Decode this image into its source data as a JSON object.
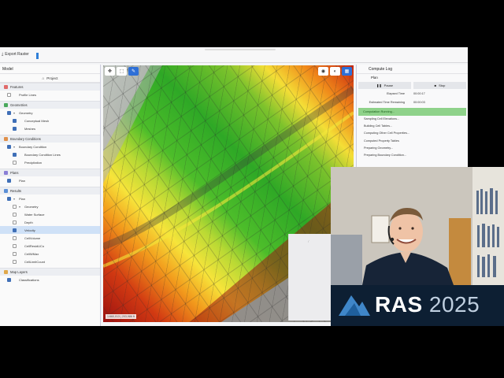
{
  "topbar": {
    "export_label": "Export Raster"
  },
  "model_panel": {
    "title": "Model",
    "project_label": "Project",
    "sections": [
      {
        "id": "features",
        "label": "Features",
        "color": "#e06a6a",
        "items": [
          {
            "label": "Profile Lines",
            "checked": false,
            "indent": 1
          }
        ]
      },
      {
        "id": "geometries",
        "label": "Geometries",
        "color": "#49a85c",
        "items": [
          {
            "label": "Geometry",
            "checked": true,
            "indent": 1,
            "caret": true
          },
          {
            "label": "Conceptual Mesh",
            "checked": true,
            "indent": 2
          },
          {
            "label": "Meshes",
            "checked": true,
            "indent": 2
          }
        ]
      },
      {
        "id": "boundary",
        "label": "Boundary Conditions",
        "color": "#e0904a",
        "items": [
          {
            "label": "Boundary Condition",
            "checked": true,
            "indent": 1,
            "caret": true
          },
          {
            "label": "Boundary Condition Lines",
            "checked": true,
            "indent": 2
          },
          {
            "label": "Precipitation",
            "checked": false,
            "indent": 2
          }
        ]
      },
      {
        "id": "plans",
        "label": "Plans",
        "color": "#8a7fd6",
        "items": [
          {
            "label": "Plan",
            "checked": true,
            "indent": 1
          }
        ]
      },
      {
        "id": "results",
        "label": "Results",
        "color": "#5b8fd6",
        "items": [
          {
            "label": "Plan",
            "checked": true,
            "indent": 1,
            "caret": true
          },
          {
            "label": "Geometry",
            "checked": false,
            "indent": 2,
            "caret": true
          },
          {
            "label": "Water Surface",
            "checked": false,
            "indent": 2
          },
          {
            "label": "Depth",
            "checked": false,
            "indent": 2
          },
          {
            "label": "Velocity",
            "checked": true,
            "indent": 2,
            "selected": true
          },
          {
            "label": "CellVolume",
            "checked": false,
            "indent": 2
          },
          {
            "label": "CellResidUCo",
            "checked": false,
            "indent": 2
          },
          {
            "label": "CellWMax",
            "checked": false,
            "indent": 2
          },
          {
            "label": "CellLimitCount",
            "checked": false,
            "indent": 2
          }
        ]
      },
      {
        "id": "maplayers",
        "label": "Map Layers",
        "color": "#e0a84a",
        "items": [
          {
            "label": "Classifications",
            "checked": true,
            "indent": 1
          }
        ]
      }
    ]
  },
  "map": {
    "scale_text": "1:660,013  |  203,986 ft"
  },
  "compute_log": {
    "title": "Compute Log",
    "plan_label": "Plan",
    "pause_label": "Pause",
    "stop_label": "Stop",
    "elapsed_label": "Elapsed Time",
    "elapsed_value": "00:00:17",
    "remaining_label": "Estimated Time Remaining",
    "remaining_value": "00:00:03",
    "status_text": "Computation Running...",
    "steps": [
      "Sampling Cell Elevations...",
      "Building Cell Tables...",
      "Computing Other Cell Properties...",
      "Computed Property Tables",
      "Preparing Geometry...",
      "Preparing Boundary Condition..."
    ]
  },
  "brand": {
    "product_bold": "RAS",
    "product_year": "2025"
  },
  "colors": {
    "accent": "#2e6fd6",
    "status_green": "#8fd28a",
    "brand_bg": "#0d1f33"
  }
}
